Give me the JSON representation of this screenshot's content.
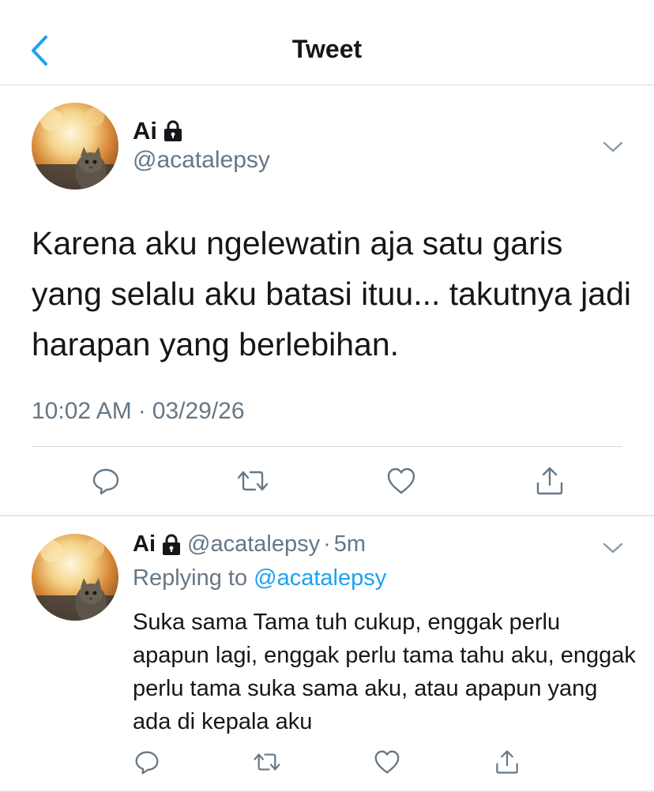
{
  "header": {
    "title": "Tweet",
    "back_icon": "chevron-left-icon",
    "accent": "#1da1f2"
  },
  "tweet": {
    "name": "Ai",
    "lock_icon": "lock-icon",
    "handle": "@acatalepsy",
    "text": "Karena aku ngelewatin aja satu garis yang selalu aku batasi ituu... takutnya jadi harapan yang berlebihan.",
    "time": "10:02 AM",
    "separator": "·",
    "date": "03/29/26",
    "actions": [
      "reply-icon",
      "retweet-icon",
      "like-icon",
      "share-icon"
    ]
  },
  "reply": {
    "name": "Ai",
    "handle": "@acatalepsy",
    "separator": "·",
    "time": "5m",
    "replying_prefix": "Replying to",
    "replying_handle": "@acatalepsy",
    "text": "Suka sama Tama tuh cukup, enggak perlu apapun lagi, enggak perlu tama tahu aku, enggak perlu tama suka sama aku, atau apapun yang ada di kepala aku",
    "actions": [
      "reply-icon",
      "retweet-icon",
      "like-icon",
      "share-icon"
    ]
  },
  "colors": {
    "text": "#14171a",
    "secondary": "#657786",
    "link": "#1da1f2",
    "divider": "#d6dadd"
  }
}
